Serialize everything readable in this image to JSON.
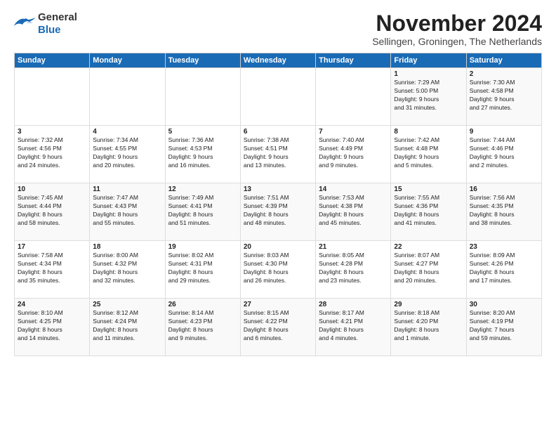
{
  "logo": {
    "general": "General",
    "blue": "Blue"
  },
  "title": "November 2024",
  "subtitle": "Sellingen, Groningen, The Netherlands",
  "days_of_week": [
    "Sunday",
    "Monday",
    "Tuesday",
    "Wednesday",
    "Thursday",
    "Friday",
    "Saturday"
  ],
  "weeks": [
    [
      {
        "day": "",
        "info": ""
      },
      {
        "day": "",
        "info": ""
      },
      {
        "day": "",
        "info": ""
      },
      {
        "day": "",
        "info": ""
      },
      {
        "day": "",
        "info": ""
      },
      {
        "day": "1",
        "info": "Sunrise: 7:29 AM\nSunset: 5:00 PM\nDaylight: 9 hours\nand 31 minutes."
      },
      {
        "day": "2",
        "info": "Sunrise: 7:30 AM\nSunset: 4:58 PM\nDaylight: 9 hours\nand 27 minutes."
      }
    ],
    [
      {
        "day": "3",
        "info": "Sunrise: 7:32 AM\nSunset: 4:56 PM\nDaylight: 9 hours\nand 24 minutes."
      },
      {
        "day": "4",
        "info": "Sunrise: 7:34 AM\nSunset: 4:55 PM\nDaylight: 9 hours\nand 20 minutes."
      },
      {
        "day": "5",
        "info": "Sunrise: 7:36 AM\nSunset: 4:53 PM\nDaylight: 9 hours\nand 16 minutes."
      },
      {
        "day": "6",
        "info": "Sunrise: 7:38 AM\nSunset: 4:51 PM\nDaylight: 9 hours\nand 13 minutes."
      },
      {
        "day": "7",
        "info": "Sunrise: 7:40 AM\nSunset: 4:49 PM\nDaylight: 9 hours\nand 9 minutes."
      },
      {
        "day": "8",
        "info": "Sunrise: 7:42 AM\nSunset: 4:48 PM\nDaylight: 9 hours\nand 5 minutes."
      },
      {
        "day": "9",
        "info": "Sunrise: 7:44 AM\nSunset: 4:46 PM\nDaylight: 9 hours\nand 2 minutes."
      }
    ],
    [
      {
        "day": "10",
        "info": "Sunrise: 7:45 AM\nSunset: 4:44 PM\nDaylight: 8 hours\nand 58 minutes."
      },
      {
        "day": "11",
        "info": "Sunrise: 7:47 AM\nSunset: 4:43 PM\nDaylight: 8 hours\nand 55 minutes."
      },
      {
        "day": "12",
        "info": "Sunrise: 7:49 AM\nSunset: 4:41 PM\nDaylight: 8 hours\nand 51 minutes."
      },
      {
        "day": "13",
        "info": "Sunrise: 7:51 AM\nSunset: 4:39 PM\nDaylight: 8 hours\nand 48 minutes."
      },
      {
        "day": "14",
        "info": "Sunrise: 7:53 AM\nSunset: 4:38 PM\nDaylight: 8 hours\nand 45 minutes."
      },
      {
        "day": "15",
        "info": "Sunrise: 7:55 AM\nSunset: 4:36 PM\nDaylight: 8 hours\nand 41 minutes."
      },
      {
        "day": "16",
        "info": "Sunrise: 7:56 AM\nSunset: 4:35 PM\nDaylight: 8 hours\nand 38 minutes."
      }
    ],
    [
      {
        "day": "17",
        "info": "Sunrise: 7:58 AM\nSunset: 4:34 PM\nDaylight: 8 hours\nand 35 minutes."
      },
      {
        "day": "18",
        "info": "Sunrise: 8:00 AM\nSunset: 4:32 PM\nDaylight: 8 hours\nand 32 minutes."
      },
      {
        "day": "19",
        "info": "Sunrise: 8:02 AM\nSunset: 4:31 PM\nDaylight: 8 hours\nand 29 minutes."
      },
      {
        "day": "20",
        "info": "Sunrise: 8:03 AM\nSunset: 4:30 PM\nDaylight: 8 hours\nand 26 minutes."
      },
      {
        "day": "21",
        "info": "Sunrise: 8:05 AM\nSunset: 4:28 PM\nDaylight: 8 hours\nand 23 minutes."
      },
      {
        "day": "22",
        "info": "Sunrise: 8:07 AM\nSunset: 4:27 PM\nDaylight: 8 hours\nand 20 minutes."
      },
      {
        "day": "23",
        "info": "Sunrise: 8:09 AM\nSunset: 4:26 PM\nDaylight: 8 hours\nand 17 minutes."
      }
    ],
    [
      {
        "day": "24",
        "info": "Sunrise: 8:10 AM\nSunset: 4:25 PM\nDaylight: 8 hours\nand 14 minutes."
      },
      {
        "day": "25",
        "info": "Sunrise: 8:12 AM\nSunset: 4:24 PM\nDaylight: 8 hours\nand 11 minutes."
      },
      {
        "day": "26",
        "info": "Sunrise: 8:14 AM\nSunset: 4:23 PM\nDaylight: 8 hours\nand 9 minutes."
      },
      {
        "day": "27",
        "info": "Sunrise: 8:15 AM\nSunset: 4:22 PM\nDaylight: 8 hours\nand 6 minutes."
      },
      {
        "day": "28",
        "info": "Sunrise: 8:17 AM\nSunset: 4:21 PM\nDaylight: 8 hours\nand 4 minutes."
      },
      {
        "day": "29",
        "info": "Sunrise: 8:18 AM\nSunset: 4:20 PM\nDaylight: 8 hours\nand 1 minute."
      },
      {
        "day": "30",
        "info": "Sunrise: 8:20 AM\nSunset: 4:19 PM\nDaylight: 7 hours\nand 59 minutes."
      }
    ]
  ]
}
